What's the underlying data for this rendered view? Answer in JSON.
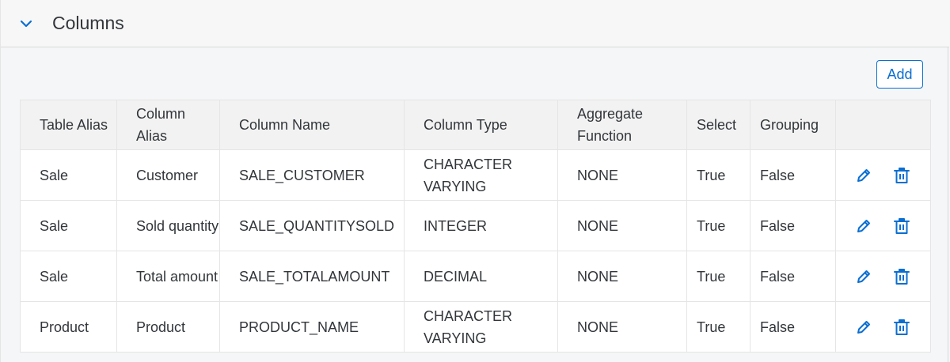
{
  "panel": {
    "title": "Columns",
    "toggle_icon": "chevron-down-icon"
  },
  "toolbar": {
    "add_label": "Add"
  },
  "table": {
    "headers": [
      "Table Alias",
      "Column Alias",
      "Column Name",
      "Column Type",
      "Aggregate Function",
      "Select",
      "Grouping",
      ""
    ],
    "rows": [
      {
        "table_alias": "Sale",
        "column_alias": "Customer",
        "column_name": "SALE_CUSTOMER",
        "column_type": "CHARACTER VARYING",
        "aggregate": "NONE",
        "select": "True",
        "grouping": "False"
      },
      {
        "table_alias": "Sale",
        "column_alias": "Sold quantity",
        "column_name": "SALE_QUANTITYSOLD",
        "column_type": "INTEGER",
        "aggregate": "NONE",
        "select": "True",
        "grouping": "False"
      },
      {
        "table_alias": "Sale",
        "column_alias": "Total amount",
        "column_name": "SALE_TOTALAMOUNT",
        "column_type": "DECIMAL",
        "aggregate": "NONE",
        "select": "True",
        "grouping": "False"
      },
      {
        "table_alias": "Product",
        "column_alias": "Product",
        "column_name": "PRODUCT_NAME",
        "column_type": "CHARACTER VARYING",
        "aggregate": "NONE",
        "select": "True",
        "grouping": "False"
      }
    ],
    "row_action_icons": [
      "pencil-icon",
      "trash-icon"
    ]
  },
  "colors": {
    "accent": "#0a6ed1",
    "true": "#107e3e",
    "false": "#bb0000"
  }
}
